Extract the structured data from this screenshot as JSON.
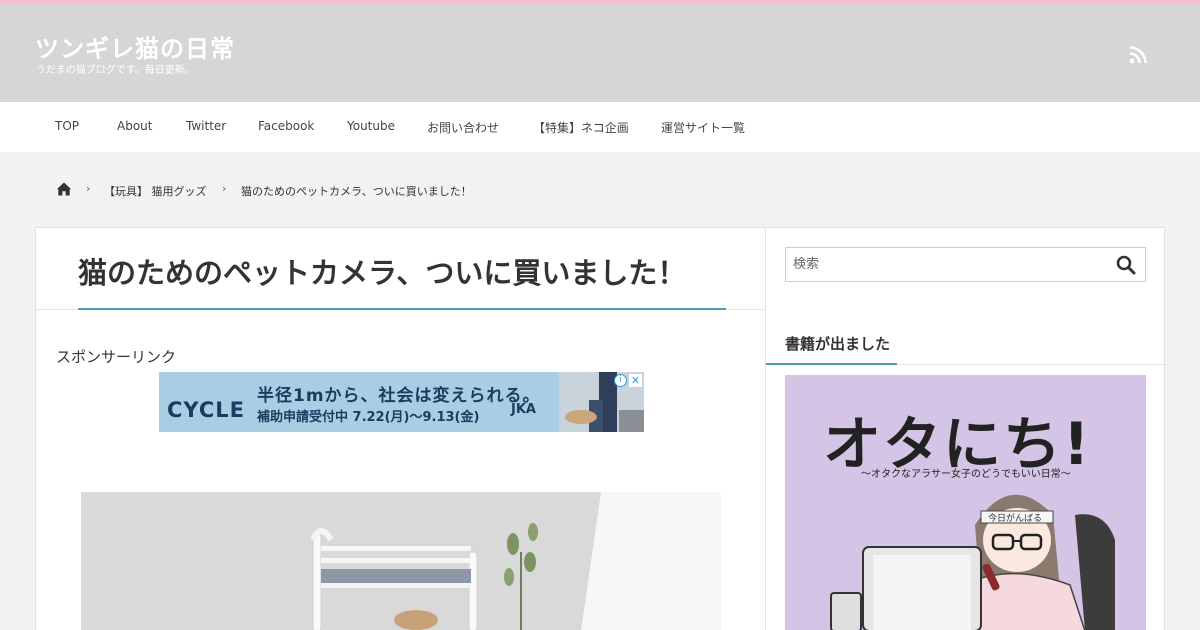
{
  "header": {
    "site_title": "ツンギレ猫の日常",
    "site_description": "うだまの猫ブログです。毎日更新。",
    "rss_icon": "rss-icon",
    "top_border_color": "#f3bfd0",
    "background_color": "#d6d6d6"
  },
  "nav": {
    "items": [
      {
        "label": "TOP"
      },
      {
        "label": "About"
      },
      {
        "label": "Twitter"
      },
      {
        "label": "Facebook"
      },
      {
        "label": "Youtube"
      },
      {
        "label": "お問い合わせ"
      },
      {
        "label": "【特集】ネコ企画"
      },
      {
        "label": "運営サイト一覧"
      }
    ]
  },
  "breadcrumb": {
    "home_icon": "home-icon",
    "items": [
      {
        "label": "【玩具】 猫用グッズ"
      },
      {
        "label": "猫のためのペットカメラ、ついに買いました！"
      }
    ]
  },
  "article": {
    "title": "猫のためのペットカメラ、ついに買いました！",
    "sponsor_label": "スポンサーリンク",
    "accent_color": "#4a9bb4"
  },
  "ad": {
    "brand": "CYCLE",
    "headline": "半径1mから、社会は変えられる。",
    "subline": "補助申請受付中 7.22(月)～9.13(金)",
    "logo_text": "JKA",
    "info_icon": "info-icon",
    "close_icon": "close-icon"
  },
  "sidebar": {
    "search_placeholder": "検索",
    "search_icon": "search-icon",
    "widget_title": "書籍が出ました",
    "book": {
      "title": "オタにち!",
      "subtitle": "〜オタクなアラサー女子のどうでもいい日常〜",
      "headband_text": "今日がんばる"
    }
  }
}
